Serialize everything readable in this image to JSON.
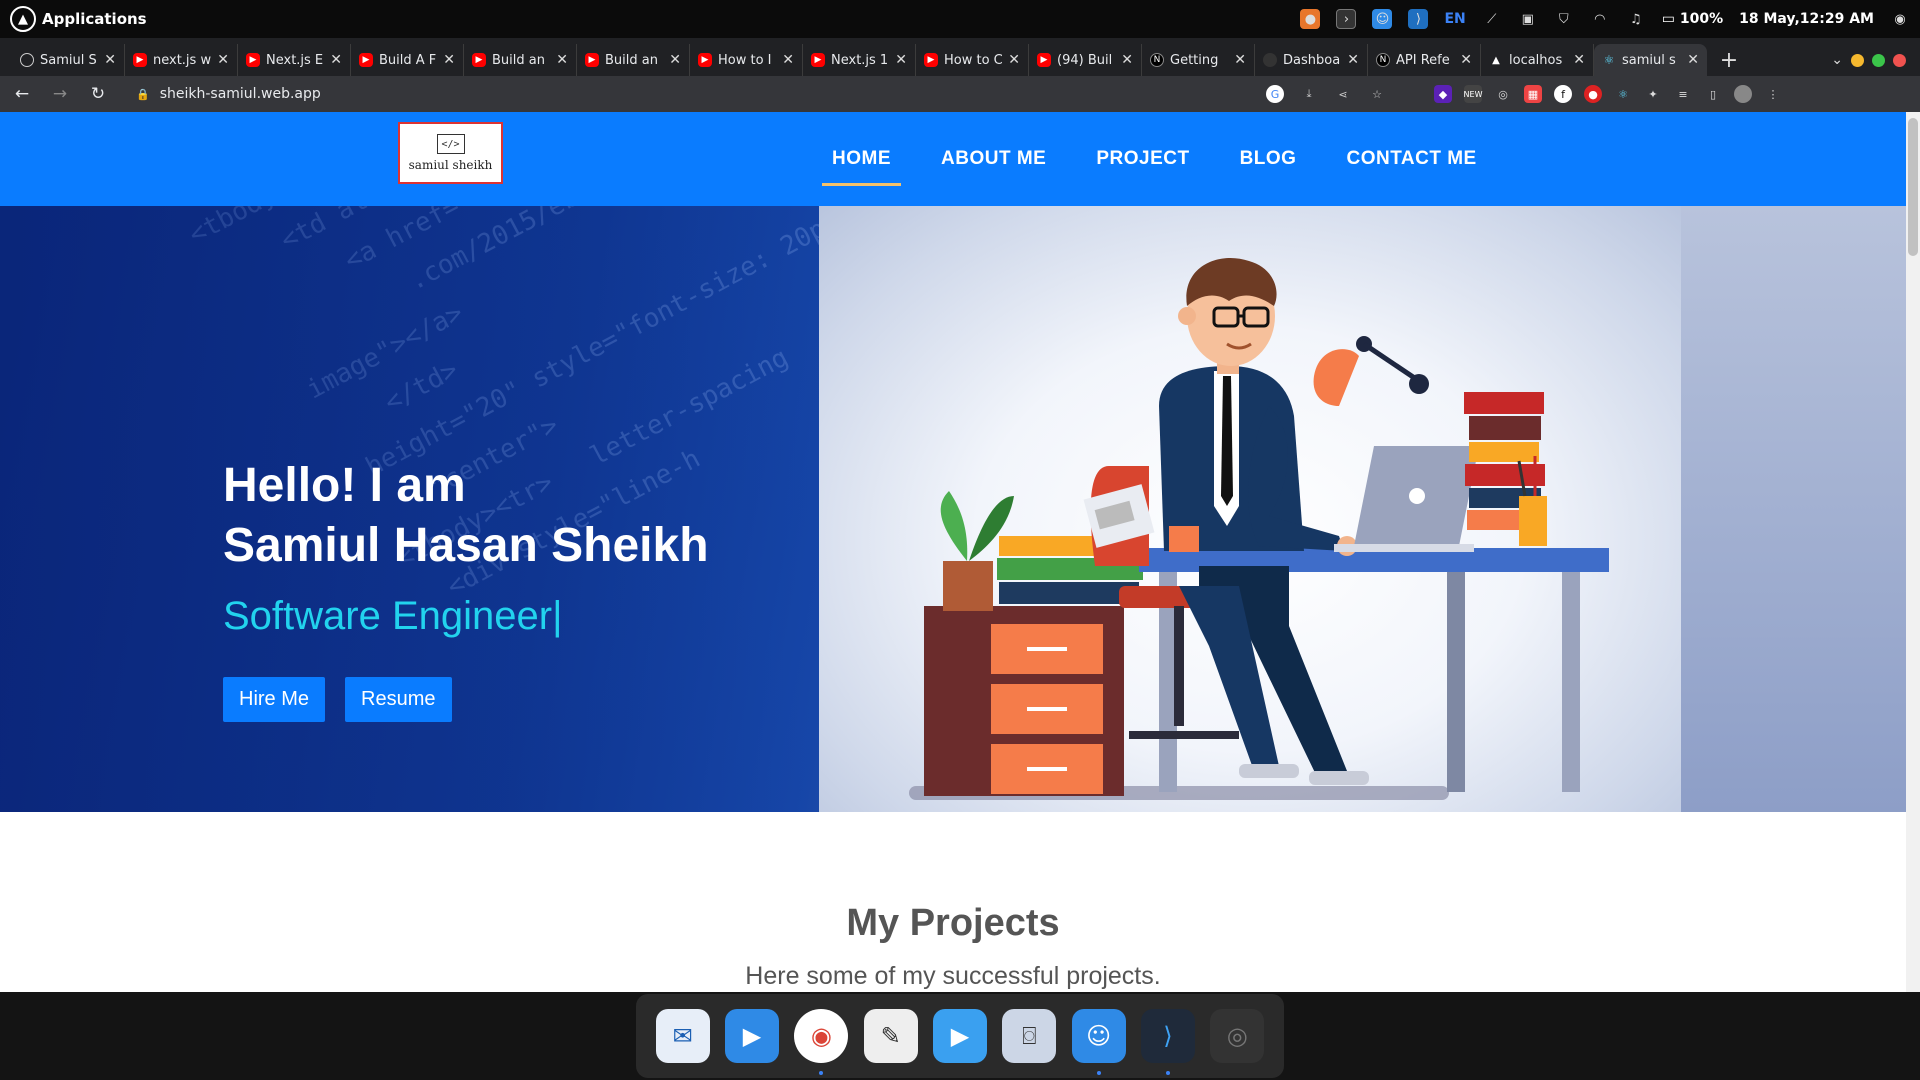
{
  "os": {
    "apps_label": "Applications",
    "lang": "EN",
    "battery": "100%",
    "datetime": "18 May,12:29 AM"
  },
  "tabs": [
    {
      "label": "Samiul S",
      "icon": "github-icon"
    },
    {
      "label": "next.js w",
      "icon": "youtube-icon"
    },
    {
      "label": "Next.js E",
      "icon": "youtube-icon"
    },
    {
      "label": "Build A F",
      "icon": "youtube-icon"
    },
    {
      "label": "Build an",
      "icon": "youtube-icon"
    },
    {
      "label": "Build an",
      "icon": "youtube-icon"
    },
    {
      "label": "How to I",
      "icon": "youtube-icon"
    },
    {
      "label": "Next.js 1",
      "icon": "youtube-icon"
    },
    {
      "label": "How to C",
      "icon": "youtube-icon"
    },
    {
      "label": "(94) Buil",
      "icon": "youtube-icon"
    },
    {
      "label": "Getting",
      "icon": "nextjs-icon"
    },
    {
      "label": "Dashboa",
      "icon": "vercel-icon"
    },
    {
      "label": "API Refe",
      "icon": "nextjs-icon"
    },
    {
      "label": "localhos",
      "icon": "triangle-icon"
    },
    {
      "label": "samiul s",
      "icon": "react-icon"
    }
  ],
  "address": {
    "url": "sheikh-samiul.web.app"
  },
  "site": {
    "logo_text": "samiul sheikh",
    "logo_code": "</>",
    "nav": [
      "HOME",
      "ABOUT ME",
      "PROJECT",
      "BLOG",
      "CONTACT ME"
    ],
    "hero": {
      "greeting": "Hello! I am",
      "name": "Samiul Hasan Sheikh",
      "role": "Software Engineer|",
      "hire_btn": "Hire Me",
      "resume_btn": "Resume"
    },
    "projects": {
      "title": "My Projects",
      "subtitle": "Here some of my successful projects."
    }
  },
  "colors": {
    "nav_bg": "#0a7cff",
    "accent_underline": "#f5c26b",
    "role_color": "#22d3ee"
  },
  "dock": [
    "thunderbird-icon",
    "media-player-icon",
    "chrome-icon",
    "text-editor-icon",
    "media-player-icon",
    "screenshot-icon",
    "finder-icon",
    "vscode-icon",
    "camera-icon"
  ]
}
